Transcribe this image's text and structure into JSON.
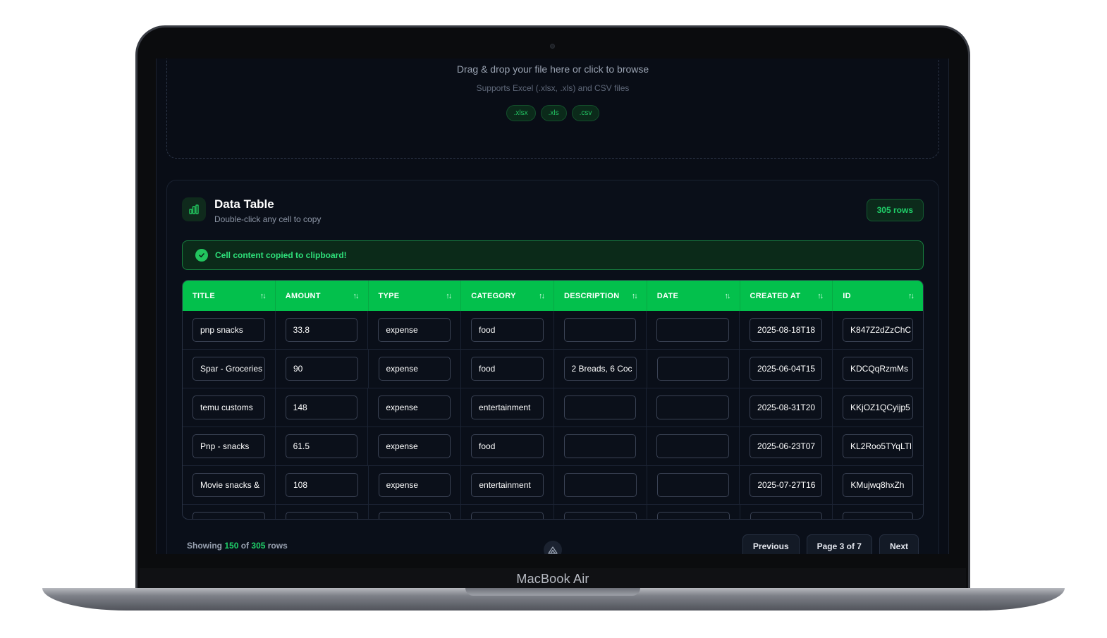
{
  "device": {
    "label": "MacBook Air"
  },
  "upload": {
    "title": "Drag & drop your file here or click to browse",
    "subtitle": "Supports Excel (.xlsx, .xls) and CSV files",
    "formats": [
      ".xlsx",
      ".xls",
      ".csv"
    ]
  },
  "card": {
    "title": "Data Table",
    "subtitle": "Double-click any cell to copy",
    "row_badge": "305 rows"
  },
  "toast": {
    "message": "Cell content copied to clipboard!"
  },
  "table": {
    "headers": [
      "TITLE",
      "AMOUNT",
      "TYPE",
      "CATEGORY",
      "DESCRIPTION",
      "DATE",
      "CREATED AT",
      "ID"
    ],
    "rows": [
      [
        "pnp snacks",
        "33.8",
        "expense",
        "food",
        "",
        "",
        "2025-08-18T18",
        "K847Z2dZzChC"
      ],
      [
        "Spar - Groceries",
        "90",
        "expense",
        "food",
        "2 Breads, 6 Coc",
        "",
        "2025-06-04T15",
        "KDCQqRzmMs"
      ],
      [
        "temu customs",
        "148",
        "expense",
        "entertainment",
        "",
        "",
        "2025-08-31T20",
        "KKjOZ1QCyijp5"
      ],
      [
        "Pnp - snacks",
        "61.5",
        "expense",
        "food",
        "",
        "",
        "2025-06-23T07",
        "KL2Roo5TYqLTl"
      ],
      [
        "Movie snacks &",
        "108",
        "expense",
        "entertainment",
        "",
        "",
        "2025-07-27T16",
        "KMujwq8hxZh"
      ]
    ]
  },
  "footer": {
    "showing_prefix": "Showing",
    "showing_count": "150",
    "of_word": "of",
    "total": "305",
    "rows_word": "rows",
    "previous": "Previous",
    "page": "Page 3 of 7",
    "next": "Next"
  },
  "colors": {
    "accent": "#03c04c",
    "background": "#090d16"
  }
}
